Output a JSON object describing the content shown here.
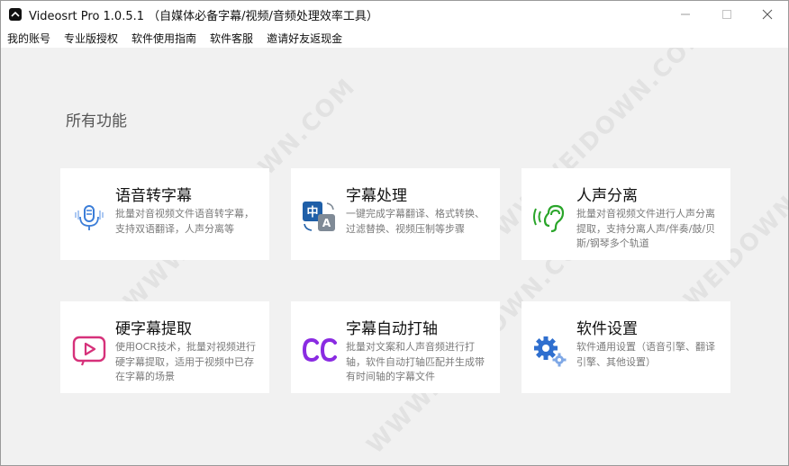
{
  "window": {
    "title": "Videosrt Pro 1.0.5.1 （自媒体必备字幕/视频/音频处理效率工具）"
  },
  "menu": [
    {
      "label": "我的账号"
    },
    {
      "label": "专业版授权"
    },
    {
      "label": "软件使用指南"
    },
    {
      "label": "软件客服"
    },
    {
      "label": "邀请好友返现金"
    }
  ],
  "section_title": "所有功能",
  "cards": [
    {
      "title": "语音转字幕",
      "desc": "批量对音视频文件语音转字幕，支持双语翻译，人声分离等",
      "icon": "microphone-icon"
    },
    {
      "title": "字幕处理",
      "desc": "一键完成字幕翻译、格式转换、过滤替换、视频压制等步骤",
      "icon": "translate-icon"
    },
    {
      "title": "人声分离",
      "desc": "批量对音视频文件进行人声分离提取，支持分离人声/伴奏/鼓/贝斯/钢琴多个轨道",
      "icon": "ear-icon"
    },
    {
      "title": "硬字幕提取",
      "desc": "使用OCR技术，批量对视频进行硬字幕提取，适用于视频中已存在字幕的场景",
      "icon": "video-play-icon"
    },
    {
      "title": "字幕自动打轴",
      "desc": "批量对文案和人声音频进行打轴，软件自动打轴匹配并生成带有时间轴的字幕文件",
      "icon": "cc-icon"
    },
    {
      "title": "软件设置",
      "desc": "软件通用设置（语音引擎、翻译引擎、其他设置）",
      "icon": "gear-icon"
    }
  ],
  "watermark": "WWW.WEIDOWN.COM",
  "colors": {
    "mic_blue": "#3b7dd8",
    "translate_blue": "#1f5fa8",
    "ear_green": "#2aa52a",
    "video_pink": "#d6317a",
    "cc_purple": "#8a2be2",
    "gear_blue": "#2f6fcf"
  }
}
